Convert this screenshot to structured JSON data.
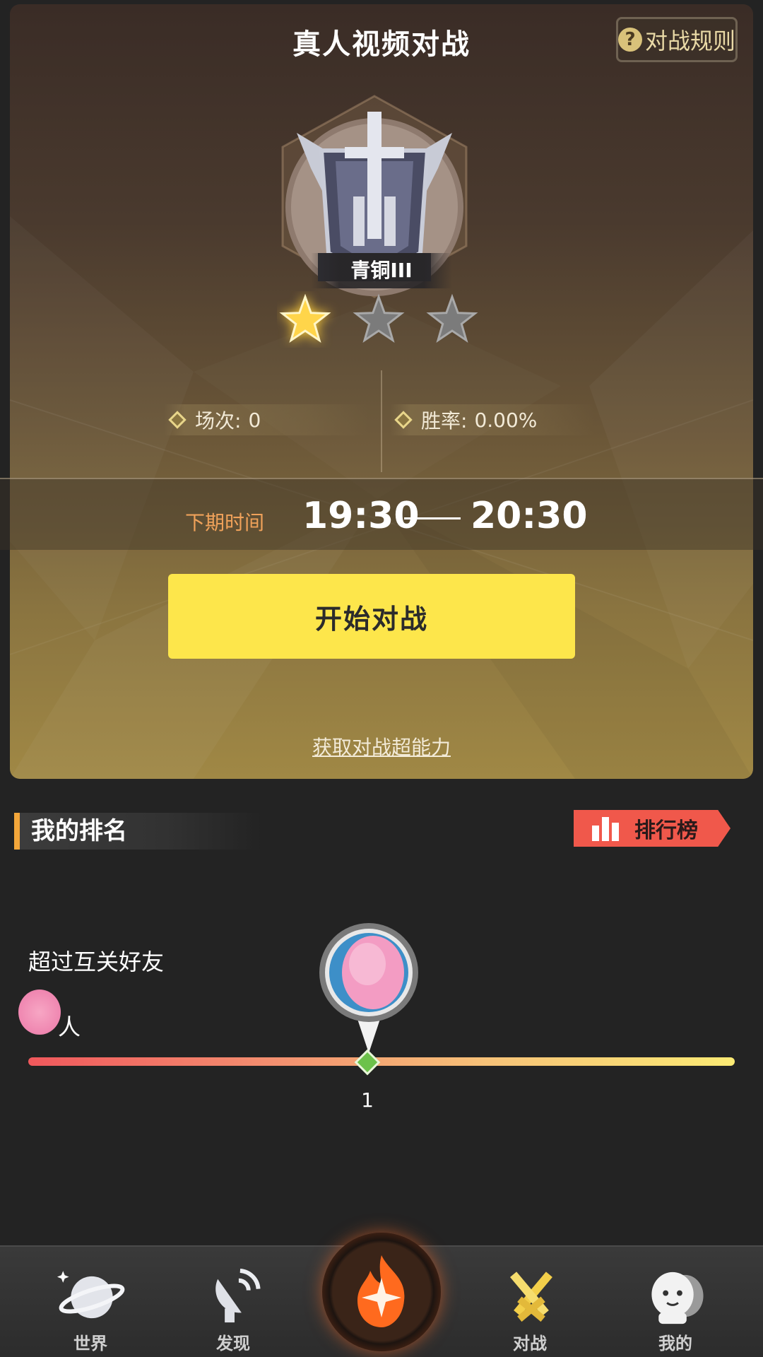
{
  "header": {
    "title": "真人视频对战",
    "rules_label": "对战规则",
    "rules_icon": "question-icon"
  },
  "rank": {
    "tier": "青铜III",
    "stars_total": 3,
    "stars_earned": 1
  },
  "stats": {
    "matches_label": "场次:",
    "matches_value": "0",
    "winrate_label": "胜率:",
    "winrate_value": "0.00%"
  },
  "schedule": {
    "label": "下期时间",
    "start": "19:30",
    "end": "20:30"
  },
  "actions": {
    "start_label": "开始对战",
    "power_link": "获取对战超能力"
  },
  "ranking": {
    "section_title": "我的排名",
    "leaderboard_label": "排行榜",
    "exceed_text": "超过互关好友",
    "unit": "人",
    "position_value": "1",
    "position_fraction": 0.48
  },
  "nav": {
    "items": [
      {
        "label": "世界",
        "icon": "planet-icon"
      },
      {
        "label": "发现",
        "icon": "satellite-dish-icon"
      },
      {
        "label": "",
        "icon": "flame-star-icon"
      },
      {
        "label": "对战",
        "icon": "crossed-swords-icon"
      },
      {
        "label": "我的",
        "icon": "ghost-profile-icon"
      }
    ]
  },
  "colors": {
    "accent_yellow": "#fde64b",
    "time_label": "#f0a25a",
    "leaderboard": "#f0584b",
    "star_gold": "#ffd54a",
    "star_grey": "#7b7b7b"
  }
}
